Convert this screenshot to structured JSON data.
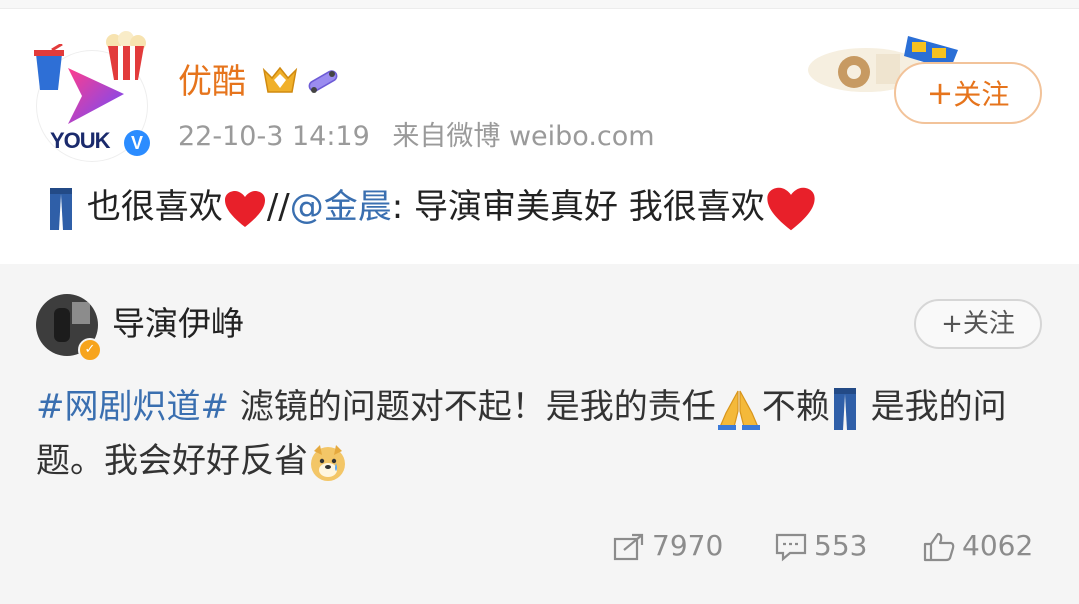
{
  "post": {
    "author": "优酷",
    "time": "22-10-3 14:19",
    "source": "来自微博 weibo.com",
    "follow_label": "关注",
    "text_before_heart": "也很喜欢",
    "sep": "//",
    "mention": "@金晨",
    "text_after_mention": ": 导演审美真好  我很喜欢",
    "avatar_logo_text": "YOUK",
    "avatar_logo_v": "V"
  },
  "repost": {
    "author": "导演伊峥",
    "follow_label": "关注",
    "hashtag": "#网剧炽道#",
    "text_part1": " 滤镜的问题对不起！是我的责任",
    "text_part2": "不赖",
    "text_part3": " 是我的问题。我会好好反省",
    "shares": "7970",
    "comments": "553",
    "likes": "4062"
  },
  "icons": [
    "jeans-icon",
    "red-heart-icon",
    "pray-icon",
    "doge-cry-icon",
    "share-icon",
    "comment-icon",
    "like-icon",
    "verified-icon",
    "crown-badge-icon",
    "skateboard-badge-icon"
  ],
  "colors": {
    "author": "#e6741c",
    "link": "#3a6fb0",
    "meta": "#9a9a9a"
  }
}
